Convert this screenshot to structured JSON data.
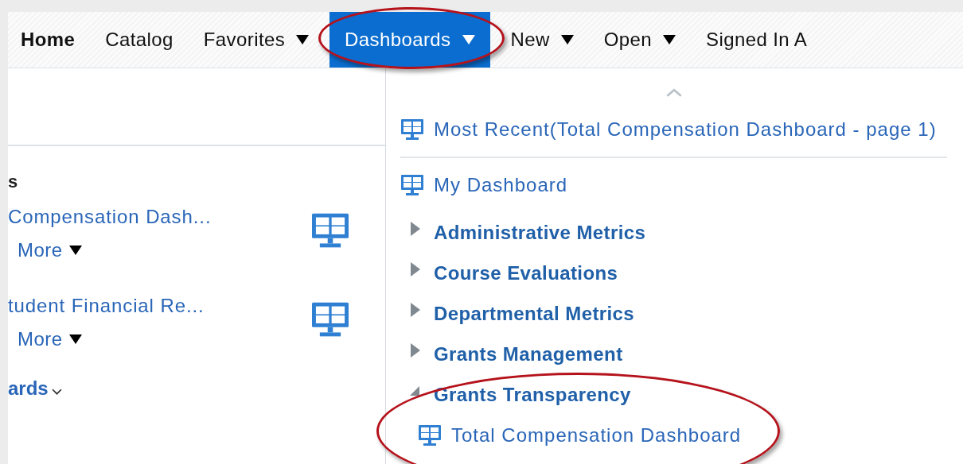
{
  "nav": [
    {
      "label": "Home",
      "selected": false,
      "current": true,
      "has_menu": false,
      "highlighted": false
    },
    {
      "label": "Catalog",
      "selected": false,
      "current": false,
      "has_menu": false,
      "highlighted": false
    },
    {
      "label": "Favorites",
      "selected": false,
      "current": false,
      "has_menu": true,
      "highlighted": false
    },
    {
      "label": "Dashboards",
      "selected": true,
      "current": false,
      "has_menu": true,
      "highlighted": true
    },
    {
      "label": "New",
      "selected": false,
      "current": false,
      "has_menu": true,
      "highlighted": false
    },
    {
      "label": "Open",
      "selected": false,
      "current": false,
      "has_menu": true,
      "highlighted": false
    },
    {
      "label": "Signed In A",
      "selected": false,
      "current": false,
      "has_menu": false,
      "highlighted": false
    }
  ],
  "page": {
    "heading": "s",
    "items": [
      {
        "title": "Compensation Dash...",
        "more": "More"
      },
      {
        "title": "tudent Financial Re...",
        "more": "More"
      }
    ],
    "footer_link": "ards"
  },
  "menu": [
    {
      "kind": "link",
      "label": "Most Recent(Total Compensation Dashboard - page 1)"
    },
    {
      "kind": "separator"
    },
    {
      "kind": "link",
      "label": "My Dashboard"
    },
    {
      "kind": "folder",
      "label": "Administrative Metrics",
      "expanded": false,
      "highlighted": false
    },
    {
      "kind": "folder",
      "label": "Course Evaluations",
      "expanded": false,
      "highlighted": false
    },
    {
      "kind": "folder",
      "label": "Departmental Metrics",
      "expanded": false,
      "highlighted": false
    },
    {
      "kind": "folder",
      "label": "Grants Management",
      "expanded": false,
      "highlighted": false
    },
    {
      "kind": "folder",
      "label": "Grants Transparency",
      "expanded": true,
      "highlighted": true,
      "children": [
        {
          "kind": "link",
          "label": "Total Compensation Dashboard"
        }
      ]
    }
  ]
}
